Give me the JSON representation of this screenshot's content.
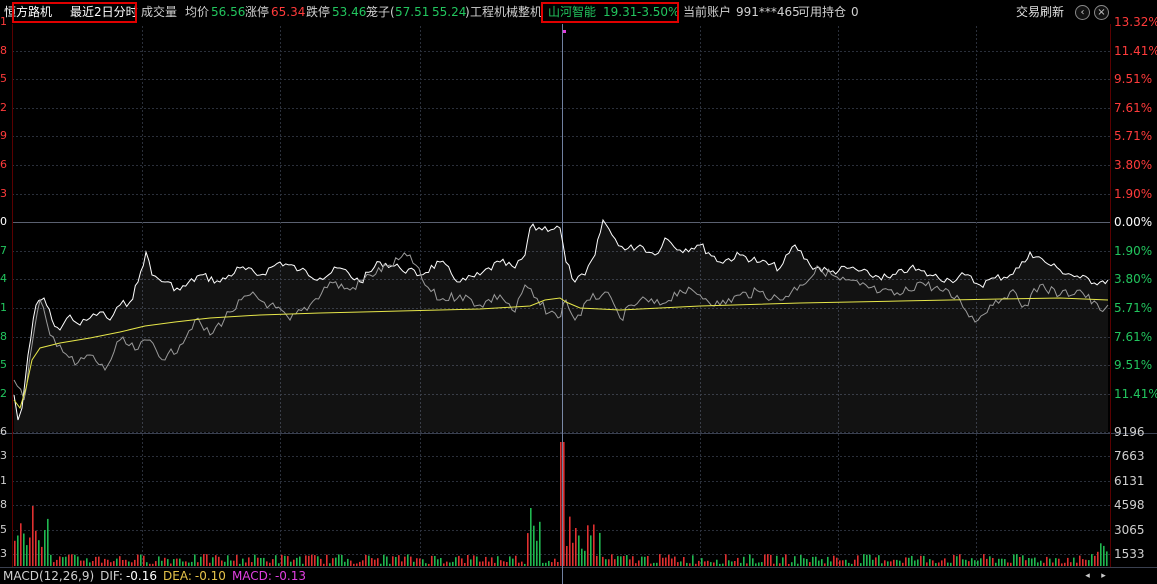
{
  "header": {
    "stock_name": "恒方路机",
    "period_label": "最近2日分时",
    "volume_label": "成交量",
    "avg_label": "均价",
    "avg_value": "56.56",
    "limit_up_label": "涨停",
    "limit_up_value": "65.34",
    "limit_down_label": "跌停",
    "limit_down_value": "53.46",
    "cage_label": "笼子",
    "cage_open": "(",
    "cage_low": "57.51",
    "cage_high": "55.24",
    "cage_close": ")",
    "sector": "工程机械整机",
    "compare_stock": "山河智能",
    "compare_price": "19.31",
    "compare_pct": "-3.50%",
    "account_label": "当前账户",
    "account_id": "991***465",
    "holding_label": "可用持仓",
    "holding_value": "0",
    "trade_refresh": "交易刷新"
  },
  "icons": {
    "prev": "‹",
    "close": "×",
    "nav_left": "◂",
    "nav_right": "▸"
  },
  "colors": {
    "up": "#ff3b3b",
    "down": "#22c55e",
    "avg_line": "#e6e64a",
    "price_line": "#ffffff",
    "compare_line": "#9a9a9a",
    "grid": "#2a2f3a",
    "macd_magenta": "#e040e0",
    "dea_yellow": "#e6c34a"
  },
  "price_axis_right": [
    "13.32%",
    "11.41%",
    "9.51%",
    "7.61%",
    "5.71%",
    "3.80%",
    "1.90%",
    "0.00%",
    "1.90%",
    "3.80%",
    "5.71%",
    "7.61%",
    "9.51%",
    "11.41%"
  ],
  "price_axis_left": [
    "1",
    "8",
    "5",
    "2",
    "9",
    "6",
    "3",
    "0",
    "7",
    "4",
    "1",
    "8",
    "5",
    "2"
  ],
  "volume_axis_right": [
    "9196",
    "7663",
    "6131",
    "4598",
    "3065",
    "1533"
  ],
  "volume_axis_left": [
    "6",
    "3",
    "1",
    "8",
    "5",
    "3"
  ],
  "macd": {
    "label": "MACD(12,26,9)",
    "dif_label": "DIF:",
    "dif_value": "-0.16",
    "dea_label": "DEA:",
    "dea_value": "-0.10",
    "macd_label": "MACD:",
    "macd_value": "-0.13"
  }
}
